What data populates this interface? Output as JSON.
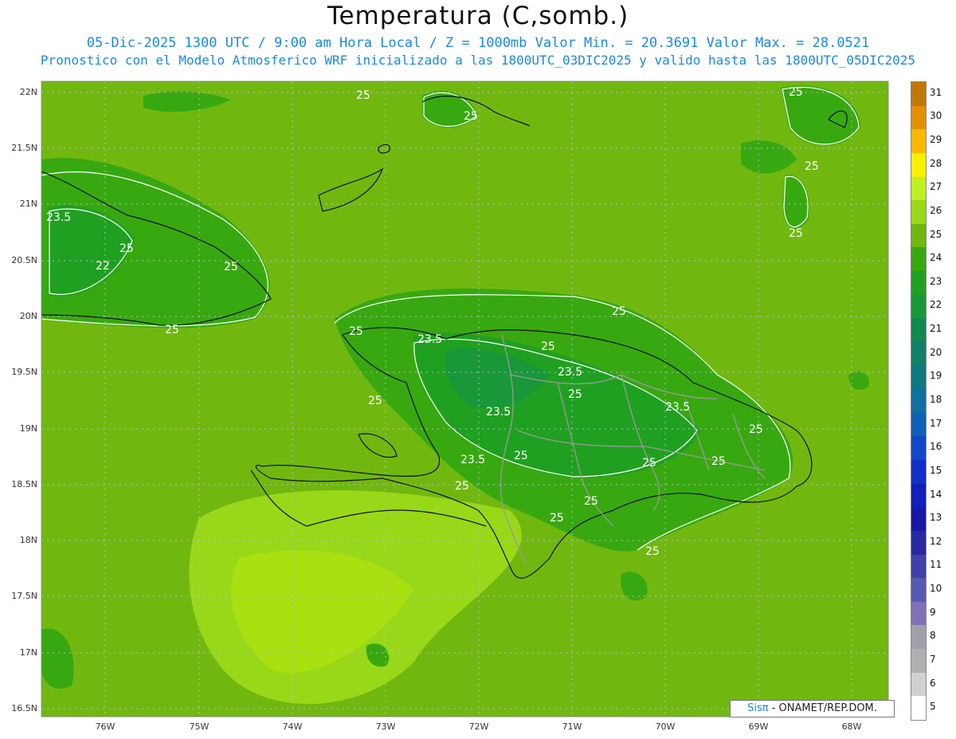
{
  "title": "Temperatura (C,somb.)",
  "subtitle_line1": "05-Dic-2025  1300 UTC / 9:00 am Hora Local / Z = 1000mb   Valor Min. = 20.3691  Valor Max. = 28.0521",
  "subtitle_line2": "Pronostico con el Modelo Atmosferico WRF inicializado a las 1800UTC_03DIC2025 y valido hasta las  1800UTC_05DIC2025",
  "credit": {
    "brand": "Sisπ",
    "text": " - ONAMET/REP.DOM."
  },
  "lat_ticks": [
    "22N",
    "21.5N",
    "21N",
    "20.5N",
    "20N",
    "19.5N",
    "19N",
    "18.5N",
    "18N",
    "17.5N",
    "17N",
    "16.5N"
  ],
  "lon_ticks": [
    "76W",
    "75W",
    "74W",
    "73W",
    "72W",
    "71W",
    "70W",
    "69W",
    "68W"
  ],
  "colorbar": {
    "levels": [
      "31",
      "30",
      "29",
      "28",
      "27",
      "26",
      "25",
      "24",
      "23",
      "22",
      "21",
      "20",
      "19",
      "18",
      "17",
      "16",
      "15",
      "14",
      "13",
      "12",
      "11",
      "10",
      "9",
      "8",
      "7",
      "6",
      "5"
    ],
    "colors": [
      "#c07800",
      "#e09000",
      "#f8b800",
      "#f8f000",
      "#c0f020",
      "#98d818",
      "#70b810",
      "#38a810",
      "#20a020",
      "#189838",
      "#108850",
      "#108068",
      "#107880",
      "#1070a0",
      "#1060b8",
      "#1048c8",
      "#1030c8",
      "#1020b8",
      "#1818a8",
      "#2828a0",
      "#4040a8",
      "#5858b0",
      "#8070b8",
      "#a0a0a8",
      "#b0b0b0",
      "#d0d0d0",
      "#ffffff"
    ]
  },
  "contour_labels": [
    "25",
    "25",
    "25",
    "25",
    "25",
    "25",
    "25",
    "25",
    "25",
    "25",
    "25",
    "25",
    "25",
    "25",
    "25",
    "25",
    "25",
    "25",
    "25",
    "23.5",
    "23.5",
    "23.5",
    "23.5",
    "23.5",
    "23.5",
    "22"
  ]
}
